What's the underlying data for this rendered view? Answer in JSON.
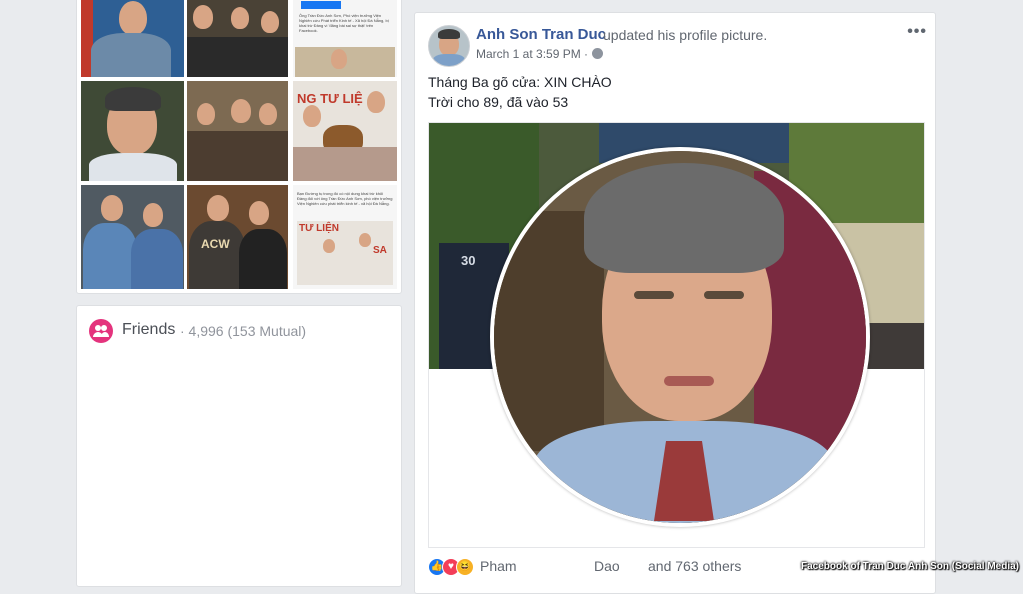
{
  "photos_grid": {
    "caption_text_1": "Ông Trần Đức Anh Sơn, Phó viện trưởng Viện Nghiên cứu Phát triển Kinh tế - Xã hội Đà Nẵng, bị khai trừ Đảng vì 'đăng bài sai sự thật' trên Facebook.",
    "caption_text_2": "Bạn Đường tụ trong đó có nội dung khai trừ khỏi Đảng đối với ông Trần Đức Anh Sơn, phó viện trưởng Viện Nghiên cứu phát triển kinh tế - xã hội Đà Nẵng.",
    "sign_text_1": "NG TƯ LIỆ",
    "sign_text_2": "TƯ LIỆN",
    "sign_text_3": "SA",
    "shirt_text": "ACW"
  },
  "friends": {
    "title": "Friends",
    "count": "· 4,996 (153 Mutual)"
  },
  "post": {
    "author": "Anh Son Tran Duc",
    "action": "updated his profile picture.",
    "timestamp": "March 1 at 3:59 PM ·",
    "more": "•••",
    "message_line_1": "Tháng Ba gõ cửa: XIN CHÀO",
    "message_line_2": "Trời cho 89, đã vào 53",
    "house_number": "30",
    "reactions": {
      "names": "Pham",
      "name_2": "Dao",
      "others": "and 763 others",
      "icons": [
        "like-icon",
        "love-icon",
        "haha-icon"
      ]
    }
  },
  "credit": "Facebook of Tran Duc Anh Son (Social Media)",
  "colors": {
    "link_blue": "#385898",
    "friends_pink": "#e4337d",
    "background": "#e9ebee"
  }
}
